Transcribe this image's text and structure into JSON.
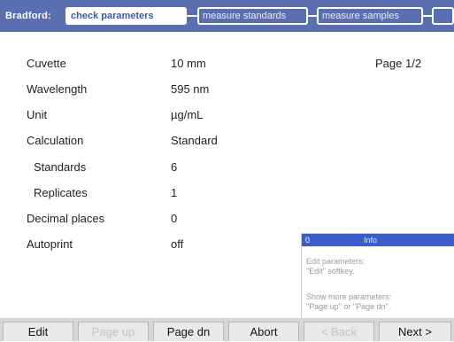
{
  "header": {
    "method_label": "Bradford:",
    "steps": [
      {
        "label": "check parameters",
        "active": true
      },
      {
        "label": "measure standards",
        "active": false
      },
      {
        "label": "measure samples",
        "active": false
      },
      {
        "label": "",
        "active": false
      }
    ]
  },
  "page_info": "Page 1/2",
  "parameters": [
    {
      "label": "Cuvette",
      "value": "10 mm"
    },
    {
      "label": "Wavelength",
      "value": "595 nm"
    },
    {
      "label": "Unit",
      "value": "µg/mL"
    },
    {
      "label": "Calculation",
      "value": "Standard"
    },
    {
      "label": "Standards",
      "value": "6"
    },
    {
      "label": "Replicates",
      "value": "1"
    },
    {
      "label": "Decimal places",
      "value": "0"
    },
    {
      "label": "Autoprint",
      "value": "off"
    }
  ],
  "info": {
    "number": "0",
    "title": "Info",
    "line1": "Edit parameters:",
    "line2": "\"Edit\" softkey.",
    "line3": "Show more parameters:",
    "line4": "\"Page up\" or \"Page dn\"."
  },
  "softkeys": [
    {
      "label": "Edit",
      "enabled": true
    },
    {
      "label": "Page up",
      "enabled": false
    },
    {
      "label": "Page dn",
      "enabled": true
    },
    {
      "label": "Abort",
      "enabled": true
    },
    {
      "label": "< Back",
      "enabled": false
    },
    {
      "label": "Next >",
      "enabled": true
    }
  ],
  "colors": {
    "header_bg": "#5a6fb0",
    "active_step_text": "#3a5aa8",
    "info_title_bg": "#3a5ec9",
    "softkey_bar_bg": "#d7d7d7"
  }
}
